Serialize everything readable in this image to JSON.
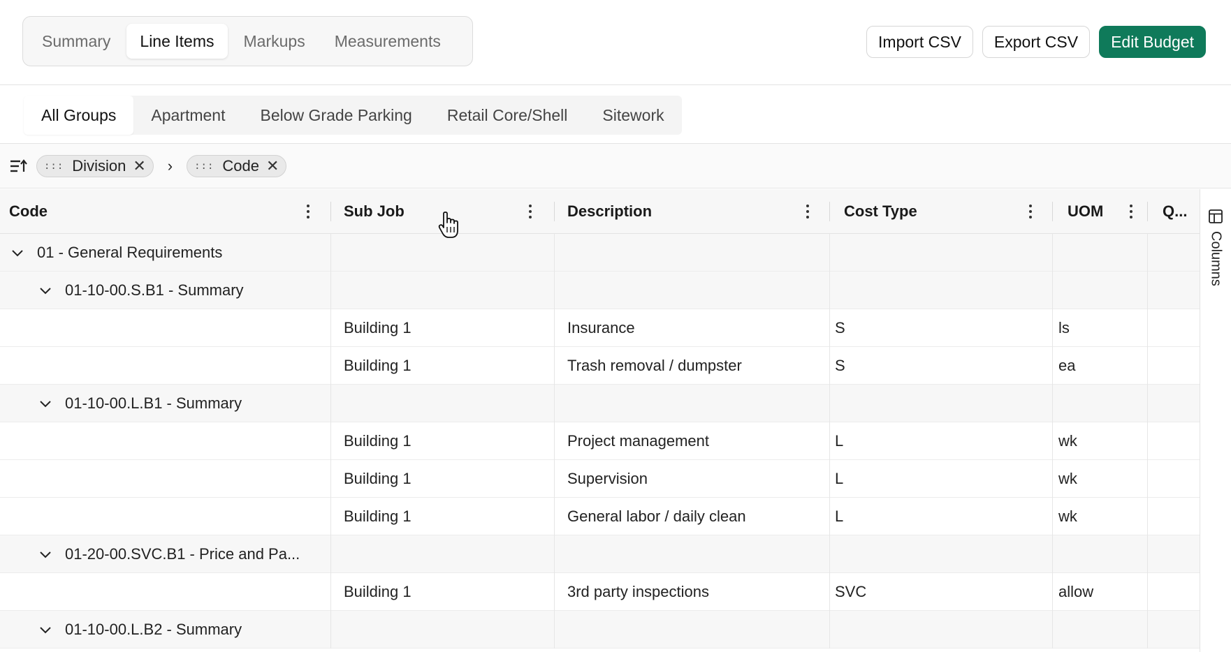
{
  "main_tabs": [
    {
      "label": "Summary",
      "active": false
    },
    {
      "label": "Line Items",
      "active": true
    },
    {
      "label": "Markups",
      "active": false
    },
    {
      "label": "Measurements",
      "active": false
    }
  ],
  "actions": {
    "import_label": "Import CSV",
    "export_label": "Export CSV",
    "edit_label": "Edit Budget"
  },
  "group_tabs": [
    {
      "label": "All Groups",
      "active": true
    },
    {
      "label": "Apartment",
      "active": false
    },
    {
      "label": "Below Grade Parking",
      "active": false
    },
    {
      "label": "Retail Core/Shell",
      "active": false
    },
    {
      "label": "Sitework",
      "active": false
    }
  ],
  "grouping": {
    "chips": [
      {
        "label": "Division"
      },
      {
        "label": "Code"
      }
    ],
    "separator": "›"
  },
  "columns": [
    {
      "label": "Code"
    },
    {
      "label": "Sub Job"
    },
    {
      "label": "Description"
    },
    {
      "label": "Cost Type"
    },
    {
      "label": "UOM"
    },
    {
      "label": "Q..."
    }
  ],
  "rows": [
    {
      "kind": "group",
      "level": 0,
      "code": "01 - General Requirements"
    },
    {
      "kind": "group",
      "level": 1,
      "code": "01-10-00.S.B1 - Summary"
    },
    {
      "kind": "item",
      "sub_job": "Building 1",
      "description": "Insurance",
      "cost_type": "S",
      "uom": "ls"
    },
    {
      "kind": "item",
      "sub_job": "Building 1",
      "description": "Trash removal / dumpster",
      "cost_type": "S",
      "uom": "ea"
    },
    {
      "kind": "group",
      "level": 1,
      "code": "01-10-00.L.B1 - Summary"
    },
    {
      "kind": "item",
      "sub_job": "Building 1",
      "description": "Project management",
      "cost_type": "L",
      "uom": "wk"
    },
    {
      "kind": "item",
      "sub_job": "Building 1",
      "description": "Supervision",
      "cost_type": "L",
      "uom": "wk"
    },
    {
      "kind": "item",
      "sub_job": "Building 1",
      "description": "General labor / daily clean",
      "cost_type": "L",
      "uom": "wk"
    },
    {
      "kind": "group",
      "level": 1,
      "code": "01-20-00.SVC.B1 - Price and Pa..."
    },
    {
      "kind": "item",
      "sub_job": "Building 1",
      "description": "3rd party inspections",
      "cost_type": "SVC",
      "uom": "allow"
    },
    {
      "kind": "group",
      "level": 1,
      "code": "01-10-00.L.B2 - Summary"
    }
  ],
  "side_panel": {
    "columns_label": "Columns",
    "icon": "columns-icon"
  },
  "colors": {
    "accent": "#0f7a5a"
  }
}
